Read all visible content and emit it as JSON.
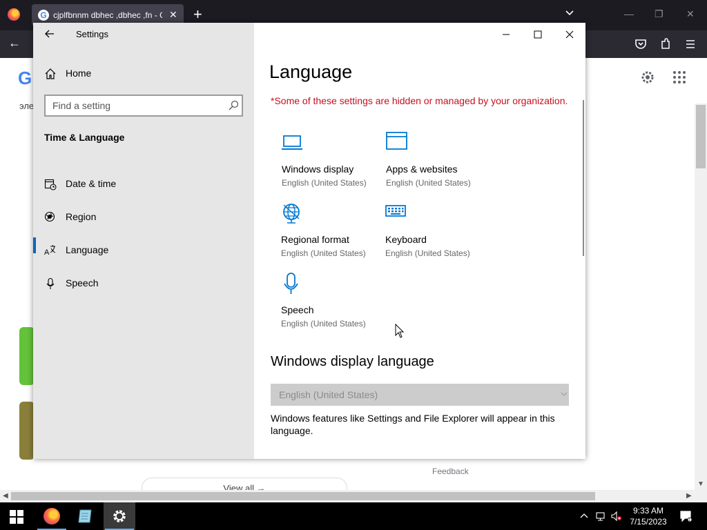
{
  "browser": {
    "tab_title": "cjplfbnnm dbhec ,dbhec ,fn - G",
    "tab_favicon": "G",
    "new_tab_glyph": "+",
    "close_glyph": "✕",
    "back_glyph": "←",
    "win_min_glyph": "—",
    "win_restore_glyph": "❐",
    "win_close_glyph": "✕",
    "icons": [
      "firefox-icon",
      "google-icon",
      "back-icon",
      "pocket-icon",
      "extensions-icon",
      "menu-icon",
      "settings-gear-icon",
      "apps-grid-icon"
    ]
  },
  "page": {
    "logo": "G",
    "snippet": "эле",
    "feedback": "Feedback",
    "view_all": "View all  →"
  },
  "settings": {
    "window_title": "Settings",
    "home_label": "Home",
    "search_placeholder": "Find a setting",
    "section_title": "Time & Language",
    "nav": [
      {
        "label": "Date & time",
        "icon": "calendar-clock-icon"
      },
      {
        "label": "Region",
        "icon": "globe-icon"
      },
      {
        "label": "Language",
        "icon": "language-icon"
      },
      {
        "label": "Speech",
        "icon": "microphone-icon"
      }
    ],
    "active_nav": "Language",
    "page_title": "Language",
    "policy_notice": "*Some of these settings are hidden or managed by your organization.",
    "tiles": [
      {
        "name": "Windows display",
        "sub": "English (United States)",
        "icon": "laptop-icon"
      },
      {
        "name": "Apps & websites",
        "sub": "English (United States)",
        "icon": "browser-window-icon"
      },
      {
        "name": "Regional format",
        "sub": "English (United States)",
        "icon": "regional-globe-icon"
      },
      {
        "name": "Keyboard",
        "sub": "English (United States)",
        "icon": "keyboard-icon"
      },
      {
        "name": "Speech",
        "sub": "English (United States)",
        "icon": "microphone-icon"
      }
    ],
    "display_language_heading": "Windows display language",
    "display_language_value": "English (United States)",
    "display_language_desc": "Windows features like Settings and File Explorer will appear in this language.",
    "accent": "#0067c0",
    "tile_icon_color": "#0078d4",
    "policy_color": "#c50f1f"
  },
  "taskbar": {
    "time": "9:33 AM",
    "date": "7/15/2023",
    "apps": [
      "firefox-icon",
      "notepad-icon",
      "settings-gear-icon"
    ]
  }
}
